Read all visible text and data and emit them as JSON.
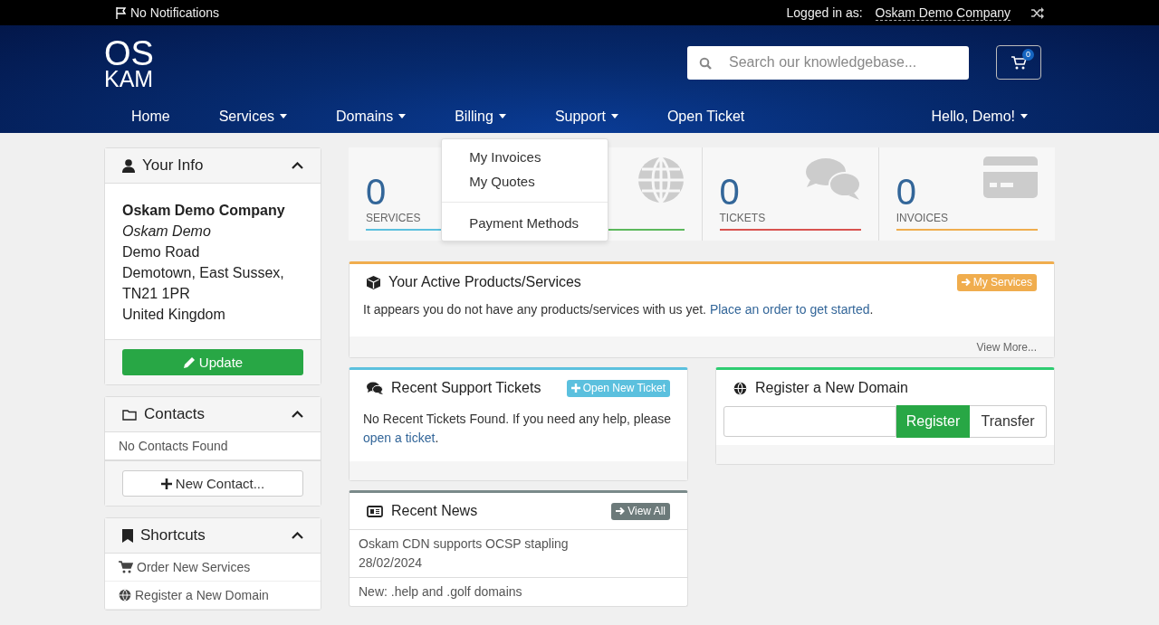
{
  "topbar": {
    "notifications": "No Notifications",
    "logged_in_label": "Logged in as:",
    "account": "Oskam Demo Company"
  },
  "logo": {
    "line1": "OS",
    "line2": "KAM"
  },
  "search": {
    "placeholder": "Search our knowledgebase..."
  },
  "cart": {
    "count": "0"
  },
  "nav": [
    {
      "label": "Home",
      "dropdown": false
    },
    {
      "label": "Services",
      "dropdown": true
    },
    {
      "label": "Domains",
      "dropdown": true
    },
    {
      "label": "Billing",
      "dropdown": true,
      "expanded": true,
      "menu": [
        [
          "My Invoices",
          "My Quotes"
        ],
        [
          "Payment Methods"
        ]
      ]
    },
    {
      "label": "Support",
      "dropdown": true
    },
    {
      "label": "Open Ticket",
      "dropdown": false
    }
  ],
  "user_menu": {
    "label": "Hello, Demo!"
  },
  "stats": [
    {
      "kind": "services",
      "count": "0",
      "label": "SERVICES",
      "color": "#5bc0de"
    },
    {
      "kind": "domains",
      "color": "#5cb85c"
    },
    {
      "kind": "tickets",
      "count": "0",
      "label": "TICKETS",
      "color": "#d9534f"
    },
    {
      "kind": "invoices",
      "count": "0",
      "label": "INVOICES",
      "color": "#f0ad4e"
    }
  ],
  "your_info": {
    "title": "Your Info",
    "company": "Oskam Demo Company",
    "name": "Oskam Demo",
    "address": [
      "Demo Road",
      "Demotown, East Sussex,",
      "TN21 1PR",
      "United Kingdom"
    ],
    "button": "Update"
  },
  "contacts": {
    "title": "Contacts",
    "empty": "No Contacts Found",
    "button": "New Contact..."
  },
  "shortcuts": {
    "title": "Shortcuts",
    "items": [
      {
        "kind": "cart",
        "label": "Order New Services"
      },
      {
        "kind": "globe",
        "label": "Register a New Domain"
      }
    ]
  },
  "products": {
    "title": "Your Active Products/Services",
    "button": "My Services",
    "text": "It appears you do not have any products/services with us yet.",
    "link": "Place an order to get started",
    "after_link": ".",
    "footer": "View More..."
  },
  "tickets": {
    "title": "Recent Support Tickets",
    "button": "Open New Ticket",
    "text": "No Recent Tickets Found. If you need any help, please",
    "link": "open a ticket",
    "after_link": "."
  },
  "domain": {
    "title": "Register a New Domain",
    "register": "Register",
    "transfer": "Transfer"
  },
  "news": {
    "title": "Recent News",
    "button": "View All",
    "items": [
      {
        "title": "Oskam CDN supports OCSP stapling",
        "date": "28/02/2024"
      },
      {
        "title": "New: .help and .golf domains"
      }
    ]
  }
}
